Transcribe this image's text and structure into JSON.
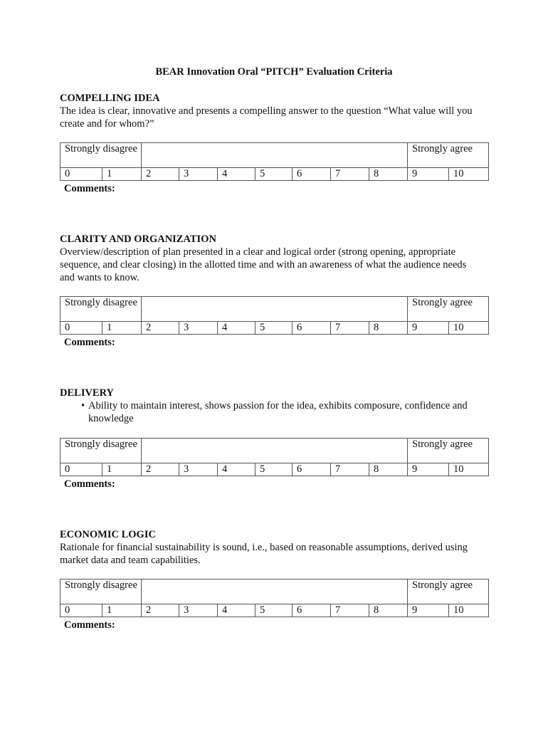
{
  "document": {
    "title": "BEAR Innovation Oral “PITCH” Evaluation Criteria"
  },
  "scale": {
    "left_label": "Strongly disagree",
    "right_label": "Strongly agree",
    "values": [
      "0",
      "1",
      "2",
      "3",
      "4",
      "5",
      "6",
      "7",
      "8",
      "9",
      "10"
    ],
    "comments_label": "Comments:"
  },
  "sections": [
    {
      "heading": "COMPELLING IDEA",
      "description": "The idea is clear, innovative and presents a compelling answer to the question “What value will you create and for whom?”"
    },
    {
      "heading": "CLARITY AND ORGANIZATION",
      "description": "Overview/description of plan presented in a clear and logical order (strong opening, appropriate sequence, and clear closing) in the allotted time and with an awareness of what the audience needs and wants to know."
    },
    {
      "heading": "DELIVERY",
      "bullets": [
        "Ability to maintain interest, shows passion for the idea, exhibits composure, confidence and knowledge"
      ],
      "bullet_glyph": "•"
    },
    {
      "heading": "ECONOMIC LOGIC",
      "description": "Rationale for financial sustainability is sound, i.e., based on reasonable assumptions, derived using market data and team capabilities."
    }
  ]
}
